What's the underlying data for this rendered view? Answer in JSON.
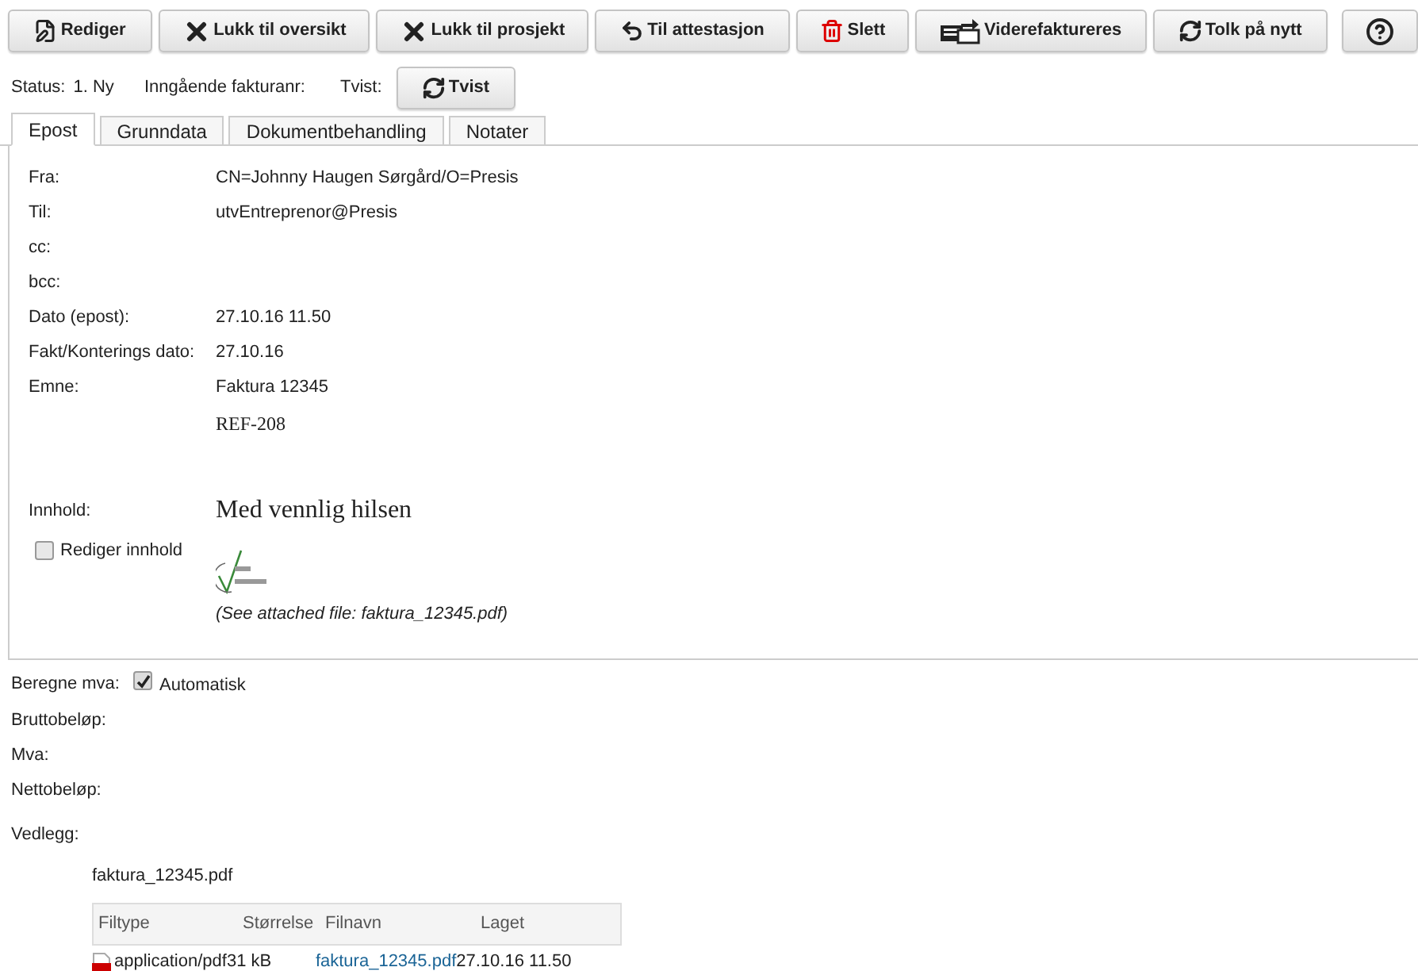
{
  "toolbar": [
    {
      "kind": "edit",
      "label": "Rediger"
    },
    {
      "kind": "close",
      "label": "Lukk til oversikt"
    },
    {
      "kind": "close",
      "label": "Lukk til prosjekt"
    },
    {
      "kind": "back",
      "label": "Til attestasjon"
    },
    {
      "kind": "delete",
      "label": "Slett"
    },
    {
      "kind": "forward",
      "label": "Viderefaktureres"
    },
    {
      "kind": "refresh",
      "label": "Tolk på nytt"
    },
    {
      "kind": "help"
    }
  ],
  "status": {
    "label": "Status:",
    "value": "1. Ny",
    "invoice_label": "Inngående fakturanr:",
    "dispute_label": "Tvist:",
    "dispute_button": "Tvist"
  },
  "tabs": [
    {
      "label": "Epost",
      "selected": true
    },
    {
      "label": "Grunndata",
      "selected": false
    },
    {
      "label": "Dokumentbehandling",
      "selected": false
    },
    {
      "label": "Notater",
      "selected": false
    }
  ],
  "email": {
    "fields": [
      {
        "label": "Fra:",
        "value": "CN=Johnny Haugen Sørgård/O=Presis"
      },
      {
        "label": "Til:",
        "value": "utvEntreprenor@Presis"
      },
      {
        "label": "cc:"
      },
      {
        "label": "bcc:"
      },
      {
        "label": "Dato (epost):",
        "value": "27.10.16 11.50"
      },
      {
        "label": "Fakt/Konterings dato:",
        "value": "27.10.16"
      },
      {
        "label": "Emne:",
        "value": "Faktura 12345"
      }
    ],
    "reference": "REF-208",
    "content_label": "Innhold:",
    "edit_content": {
      "label": "Rediger innhold",
      "checked": false
    },
    "body": "Med vennlig hilsen",
    "attachment_note": "(See attached file: faktura_12345.pdf)"
  },
  "vat": {
    "label": "Beregne mva:",
    "automatic": {
      "label": "Automatisk",
      "checked": true
    }
  },
  "amounts": [
    "Bruttobeløp:",
    "Mva:",
    "Nettobeløp:"
  ],
  "attachments": {
    "label": "Vedlegg:",
    "file_title": "faktura_12345.pdf",
    "columns": [
      "Filtype",
      "Størrelse",
      "Filnavn",
      "Laget"
    ],
    "rows": [
      {
        "type": "application/pdf",
        "size": "31 kB",
        "name": "faktura_12345.pdf",
        "created": "27.10.16 11.50"
      }
    ]
  }
}
